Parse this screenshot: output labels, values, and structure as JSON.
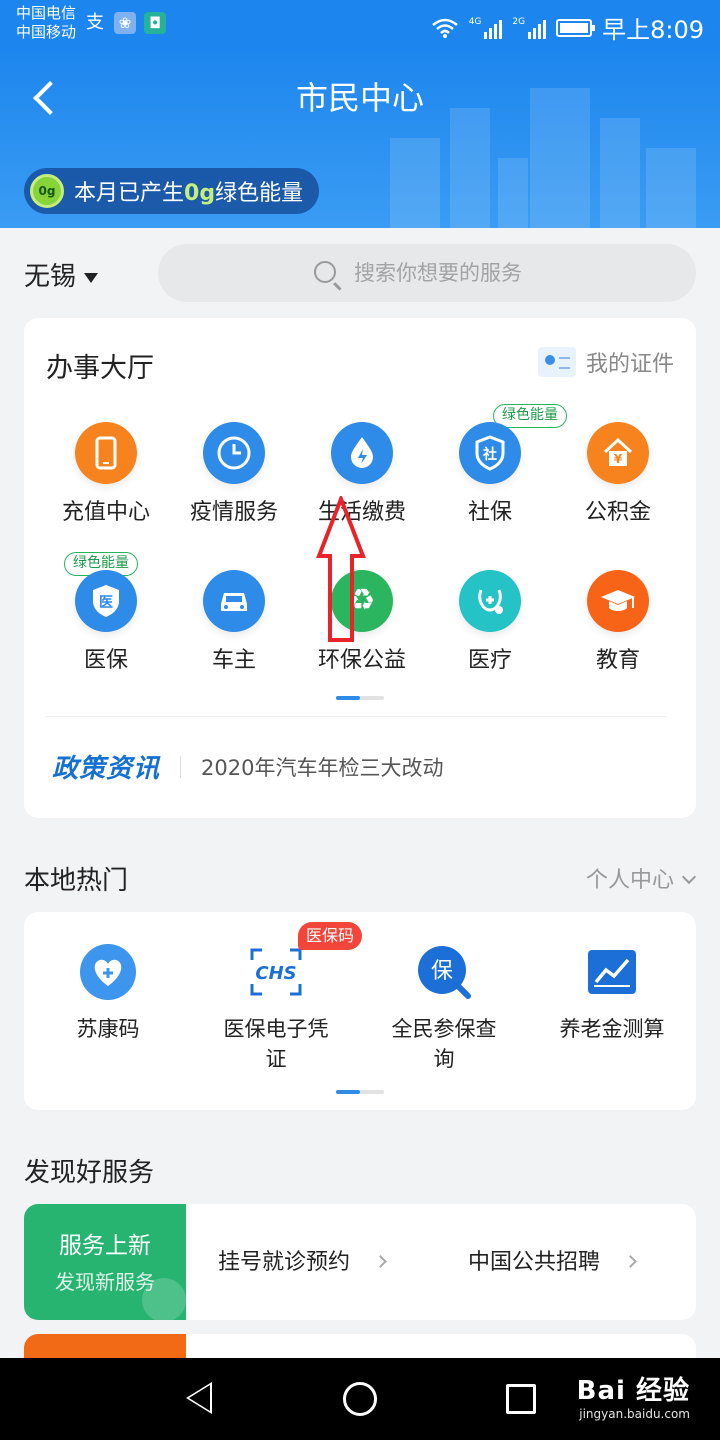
{
  "status_bar": {
    "carrier_1": "中国电信",
    "carrier_2": "中国移动",
    "network_1": "4G",
    "network_2": "2G",
    "time": "早上8:09"
  },
  "header": {
    "title": "市民中心",
    "energy_badge": "0g",
    "energy_prefix": "本月已产生",
    "energy_value": "0g",
    "energy_suffix": "绿色能量"
  },
  "location": {
    "city": "无锡",
    "search_placeholder": "搜索你想要的服务"
  },
  "service_hall": {
    "title": "办事大厅",
    "my_certificates": "我的证件",
    "items": [
      {
        "label": "充值中心",
        "icon": "phone-icon",
        "color": "#f7831f",
        "glyph": "▯"
      },
      {
        "label": "疫情服务",
        "icon": "clock-icon",
        "color": "#2f8be8",
        "glyph": "◷"
      },
      {
        "label": "生活缴费",
        "icon": "water-drop-icon",
        "color": "#2f8be8",
        "glyph": "♦"
      },
      {
        "label": "社保",
        "icon": "shield-icon",
        "color": "#2f8be8",
        "glyph": "社",
        "tag": "绿色能量"
      },
      {
        "label": "公积金",
        "icon": "house-icon",
        "color": "#f7831f",
        "glyph": "¥"
      },
      {
        "label": "医保",
        "icon": "medical-shield-icon",
        "color": "#2f8be8",
        "glyph": "医",
        "tag": "绿色能量"
      },
      {
        "label": "车主",
        "icon": "car-icon",
        "color": "#2f8be8",
        "glyph": "▬"
      },
      {
        "label": "环保公益",
        "icon": "recycle-icon",
        "color": "#2bb55e",
        "glyph": "♻"
      },
      {
        "label": "医疗",
        "icon": "stethoscope-icon",
        "color": "#25c2c6",
        "glyph": "+"
      },
      {
        "label": "教育",
        "icon": "graduation-cap-icon",
        "color": "#f76418",
        "glyph": "▲"
      }
    ],
    "policy_logo": "政策资讯",
    "policy_headline": "2020年汽车年检三大改动"
  },
  "local_hot": {
    "title": "本地热门",
    "personal_center": "个人中心",
    "items": [
      {
        "label_1": "苏康码",
        "label_2": "",
        "icon": "heart-icon"
      },
      {
        "label_1": "医保电子凭",
        "label_2": "证",
        "icon": "chs-icon",
        "badge": "医保码",
        "badge_sub": "CHS"
      },
      {
        "label_1": "全民参保查",
        "label_2": "询",
        "icon": "insurance-search-icon",
        "glyph": "保"
      },
      {
        "label_1": "养老金测算",
        "label_2": "",
        "icon": "chart-icon"
      }
    ]
  },
  "discover": {
    "title": "发现好服务",
    "new_title": "服务上新",
    "new_subtitle": "发现新服务",
    "links": [
      "挂号就诊预约",
      "中国公共招聘"
    ]
  },
  "watermark": {
    "brand": "Bai 经验",
    "url": "jingyan.baidu.com"
  },
  "colors": {
    "primary": "#1d86ee",
    "green": "#27b470",
    "orange": "#f7831f",
    "annotation_red": "#e8232a"
  }
}
